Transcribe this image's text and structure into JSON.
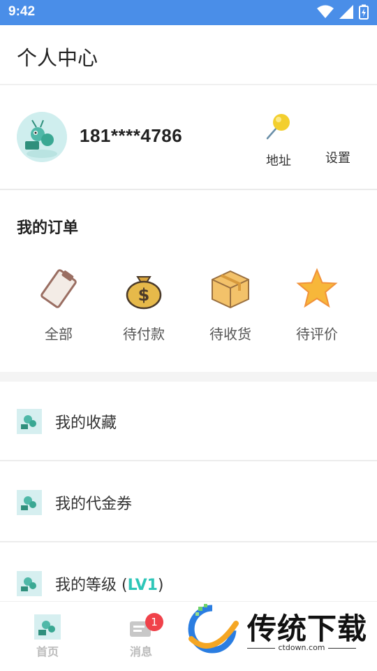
{
  "status_bar": {
    "time": "9:42"
  },
  "header": {
    "title": "个人中心"
  },
  "profile": {
    "phone": "181****4786",
    "address_label": "地址",
    "settings_label": "设置"
  },
  "orders": {
    "title": "我的订单",
    "items": [
      {
        "label": "全部",
        "icon": "clipboard-icon"
      },
      {
        "label": "待付款",
        "icon": "money-bag-icon"
      },
      {
        "label": "待收货",
        "icon": "package-box-icon"
      },
      {
        "label": "待评价",
        "icon": "star-icon"
      }
    ]
  },
  "menu": [
    {
      "label": "我的收藏"
    },
    {
      "label": "我的代金券"
    },
    {
      "label": "我的等级 (",
      "level": "LV1",
      "suffix": ")"
    }
  ],
  "tabbar": {
    "home_label": "首页",
    "messages_label": "消息",
    "messages_badge": "1"
  },
  "watermark": {
    "text": "传统下载",
    "url": "ctdown.com"
  },
  "colors": {
    "status_bar": "#4a8ee8",
    "accent": "#2ec6b8",
    "badge": "#f0424a"
  }
}
